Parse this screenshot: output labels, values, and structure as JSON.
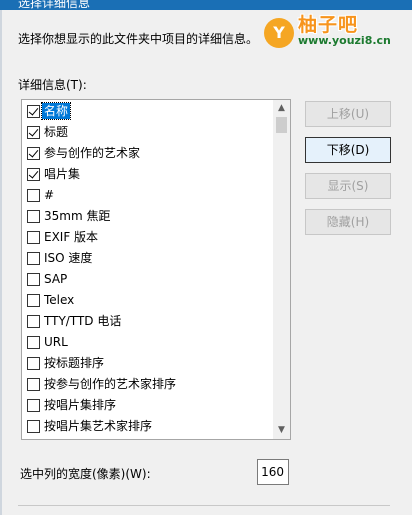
{
  "window": {
    "title": "选择详细信息"
  },
  "description": "选择你想显示的此文件夹中项目的详细信息。",
  "logo": {
    "letter": "Y",
    "name": "柚子吧",
    "url": "www.youzi8.cn"
  },
  "details_label": "详细信息(T):",
  "items": [
    {
      "label": "名称",
      "checked": true,
      "selected": true
    },
    {
      "label": "标题",
      "checked": true
    },
    {
      "label": "参与创作的艺术家",
      "checked": true
    },
    {
      "label": "唱片集",
      "checked": true
    },
    {
      "label": "#",
      "checked": false
    },
    {
      "label": "35mm 焦距",
      "checked": false
    },
    {
      "label": "EXIF 版本",
      "checked": false
    },
    {
      "label": "ISO 速度",
      "checked": false
    },
    {
      "label": "SAP",
      "checked": false
    },
    {
      "label": "Telex",
      "checked": false
    },
    {
      "label": "TTY/TTD 电话",
      "checked": false
    },
    {
      "label": "URL",
      "checked": false
    },
    {
      "label": "按标题排序",
      "checked": false
    },
    {
      "label": "按参与创作的艺术家排序",
      "checked": false
    },
    {
      "label": "按唱片集排序",
      "checked": false
    },
    {
      "label": "按唱片集艺术家排序",
      "checked": false
    }
  ],
  "buttons": {
    "move_up": "上移(U)",
    "move_down": "下移(D)",
    "show": "显示(S)",
    "hide": "隐藏(H)"
  },
  "width": {
    "label": "选中列的宽度(像素)(W):",
    "value": "160"
  },
  "scrollbar": {
    "up_icon": "chevron-up-icon",
    "down_icon": "chevron-down-icon"
  },
  "colors": {
    "selection": "#0078d7",
    "logo_orange": "#f7941d",
    "logo_green": "#1c7a2f",
    "titlebar": "#1a6fb5"
  }
}
